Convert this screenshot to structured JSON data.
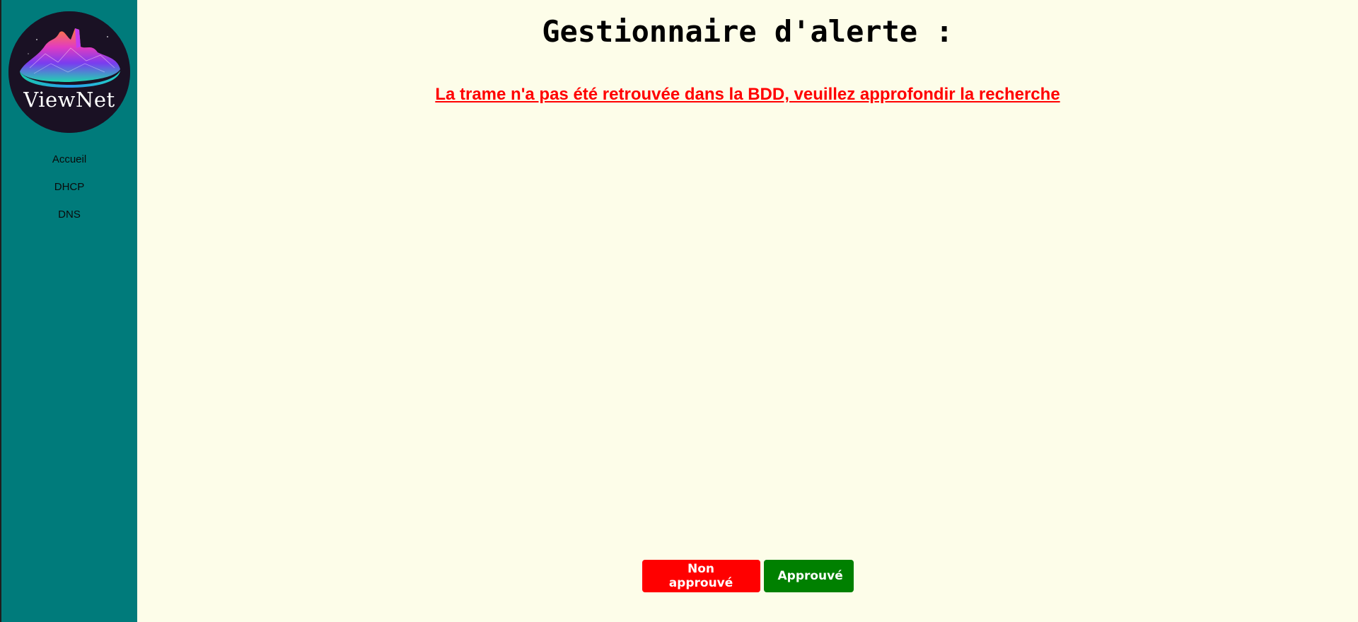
{
  "sidebar": {
    "logo_text": "ViewNet",
    "nav": [
      {
        "label": "Accueil"
      },
      {
        "label": "DHCP"
      },
      {
        "label": "DNS"
      }
    ]
  },
  "main": {
    "title": "Gestionnaire d'alerte :",
    "alert_message": "La trame n'a pas été retrouvée dans la BDD, veuillez approfondir la recherche"
  },
  "actions": {
    "reject_label": "Non approuvé",
    "approve_label": "Approuvé"
  },
  "colors": {
    "sidebar_bg": "#007b7b",
    "page_bg": "#fdfde9",
    "alert_text": "#ff0000",
    "reject_button": "#ff0000",
    "approve_button": "#008000"
  }
}
